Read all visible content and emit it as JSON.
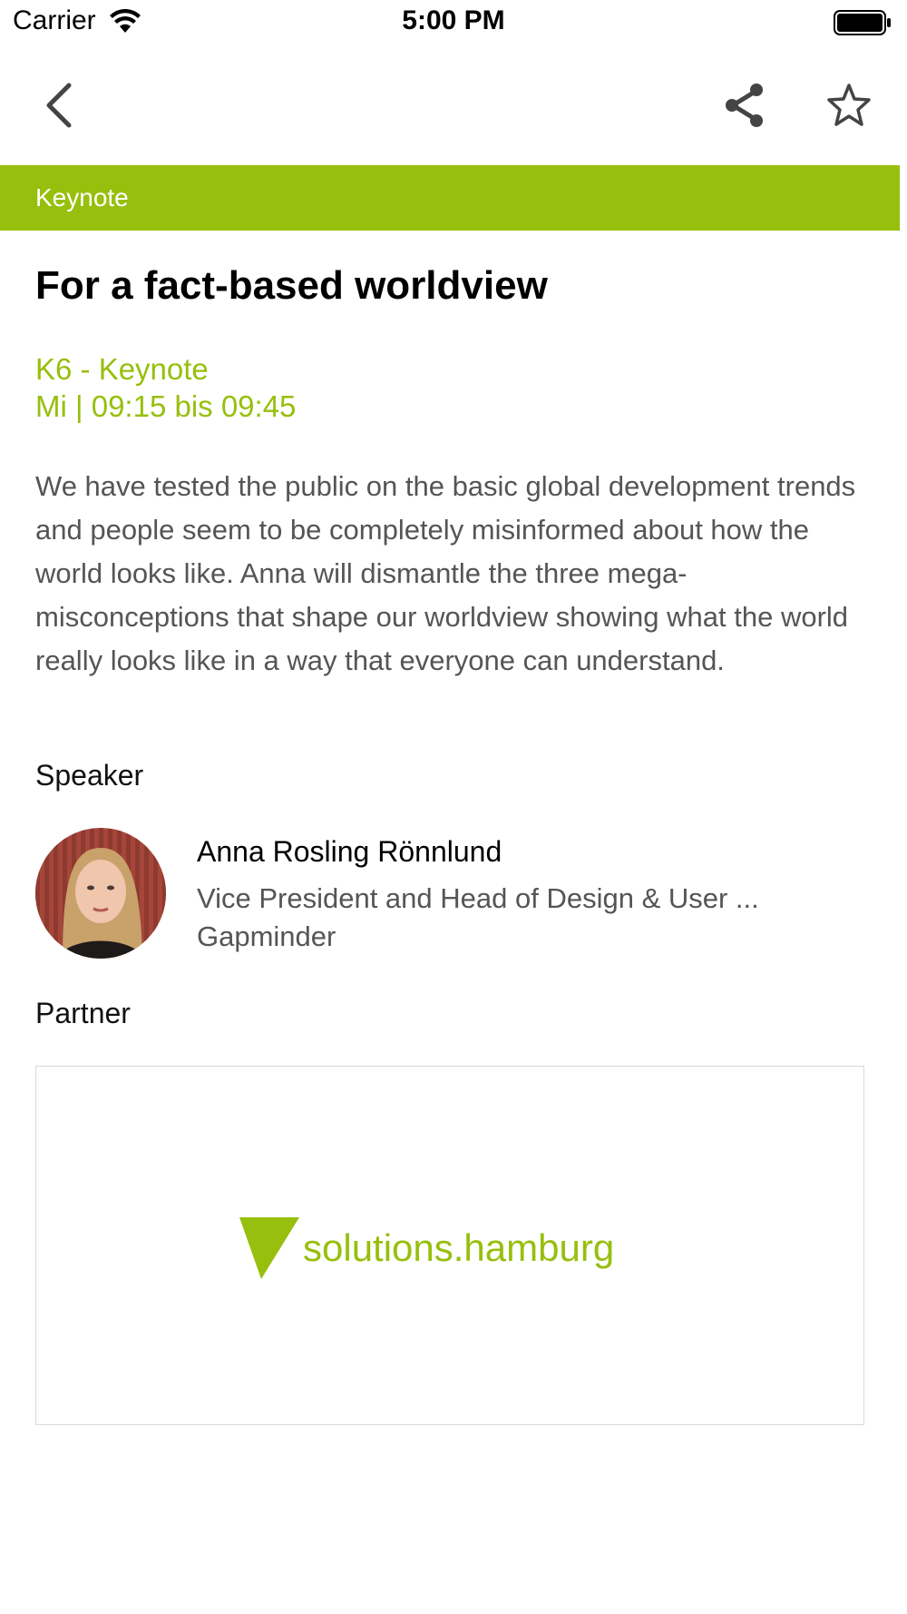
{
  "status_bar": {
    "carrier": "Carrier",
    "time": "5:00 PM"
  },
  "nav": {
    "back_icon": "chevron-left-icon",
    "share_icon": "share-icon",
    "favorite_icon": "star-outline-icon"
  },
  "category": {
    "label": "Keynote",
    "color": "#97BF0D"
  },
  "session": {
    "title": "For a fact-based worldview",
    "room": "K6 - Keynote",
    "time": "Mi | 09:15 bis 09:45",
    "accent": "#97BF0D",
    "description": "We have tested the public on the basic global development trends  and people seem to be completely misinformed about how the world looks like. Anna will dismantle the three mega-misconceptions that shape our worldview showing what the world really looks like in a way that everyone can understand."
  },
  "speaker_section": {
    "heading": "Speaker",
    "speakers": [
      {
        "name": "Anna Rosling Rönnlund",
        "role": "Vice President and Head of Design & User ...",
        "organization": "Gapminder"
      }
    ]
  },
  "partner_section": {
    "heading": "Partner",
    "logo_text": "solutions.hamburg",
    "logo_color": "#97BF0D"
  }
}
